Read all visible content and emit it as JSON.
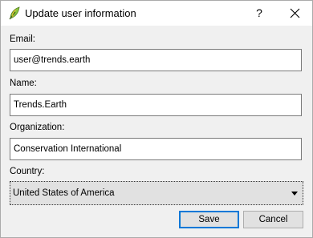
{
  "window": {
    "title": "Update user information",
    "help_label": "?",
    "accent_color": "#0078d7"
  },
  "form": {
    "email_label": "Email:",
    "email_value": "user@trends.earth",
    "name_label": "Name:",
    "name_value": "Trends.Earth",
    "organization_label": "Organization:",
    "organization_value": "Conservation International",
    "country_label": "Country:",
    "country_value": "United States of America"
  },
  "buttons": {
    "save_label": "Save",
    "cancel_label": "Cancel"
  },
  "icons": {
    "app": "qgis-leaf-icon",
    "close": "close-icon",
    "dropdown": "chevron-down-icon"
  }
}
